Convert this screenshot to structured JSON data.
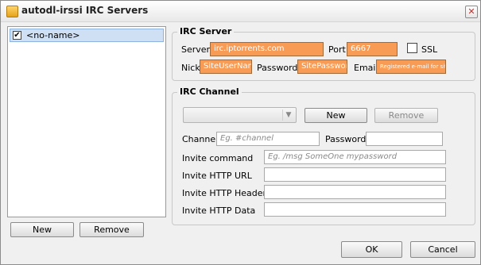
{
  "window": {
    "title": "autodl-irssi IRC Servers",
    "close_glyph": "✕"
  },
  "server_list": {
    "items": [
      {
        "label": "<no-name>",
        "checked": true
      }
    ],
    "new_label": "New",
    "remove_label": "Remove"
  },
  "irc_server": {
    "group_title": "IRC Server",
    "server_label": "Server",
    "server_value": "irc.iptorrents.com",
    "port_label": "Port",
    "port_value": "6667",
    "ssl_label": "SSL",
    "ssl_checked": false,
    "nick_label": "Nick",
    "nick_value": "SiteUserName",
    "password_label": "Password",
    "password_value": "SitePassword",
    "email_label": "Email",
    "email_value": "Registered e-mail for site"
  },
  "irc_channel": {
    "group_title": "IRC Channel",
    "new_label": "New",
    "remove_label": "Remove",
    "channel_label": "Channel",
    "channel_placeholder": "Eg. #channel",
    "password_label": "Password",
    "invite_command_label": "Invite command",
    "invite_command_placeholder": "Eg. /msg SomeOne mypassword",
    "invite_http_url_label": "Invite HTTP URL",
    "invite_http_header_label": "Invite HTTP Header",
    "invite_http_data_label": "Invite HTTP Data"
  },
  "footer": {
    "ok_label": "OK",
    "cancel_label": "Cancel"
  },
  "colors": {
    "highlight_field": "#f79b55",
    "selection": "#cfe0f5"
  }
}
